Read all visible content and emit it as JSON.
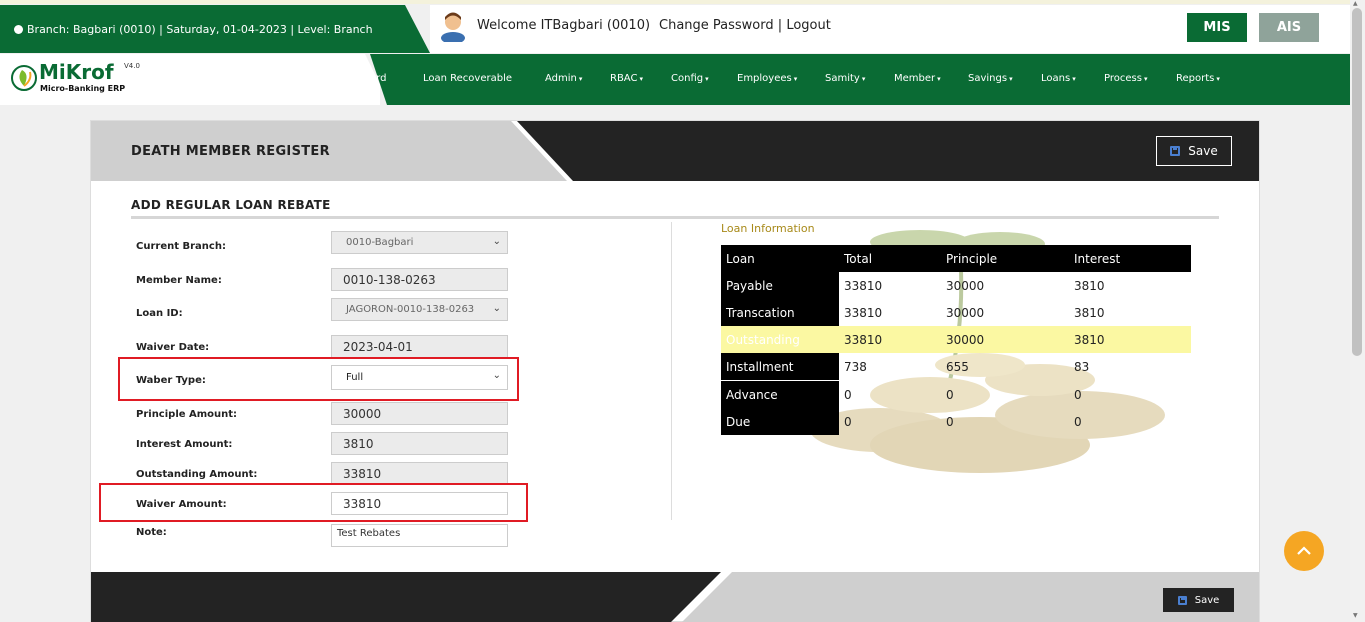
{
  "header": {
    "branch_info": "Branch: Bagbari (0010) | Saturday, 01-04-2023 | Level: Branch",
    "welcome": "Welcome ITBagbari (0010)",
    "change_password": "Change Password",
    "separator": "|",
    "logout": "Logout",
    "mis": "MIS",
    "ais": "AIS"
  },
  "logo": {
    "name": "MiKrof",
    "version": "V4.0",
    "subtitle": "Micro-Banking ERP"
  },
  "nav": {
    "items": [
      {
        "label": "ard"
      },
      {
        "label": "Loan Recoverable"
      },
      {
        "label": "Admin"
      },
      {
        "label": "RBAC"
      },
      {
        "label": "Config"
      },
      {
        "label": "Employees"
      },
      {
        "label": "Samity"
      },
      {
        "label": "Member"
      },
      {
        "label": "Savings"
      },
      {
        "label": "Loans"
      },
      {
        "label": "Process"
      },
      {
        "label": "Reports"
      }
    ]
  },
  "page": {
    "title": "DEATH MEMBER REGISTER",
    "save_label": "Save",
    "section_title": "ADD REGULAR LOAN REBATE"
  },
  "form": {
    "current_branch_label": "Current Branch:",
    "current_branch_value": "0010-Bagbari",
    "member_name_label": "Member Name:",
    "member_name_value": "0010-138-0263",
    "loan_id_label": "Loan ID:",
    "loan_id_value": "JAGORON-0010-138-0263",
    "waiver_date_label": "Waiver Date:",
    "waiver_date_value": "2023-04-01",
    "waber_type_label": "Waber Type:",
    "waber_type_value": "Full",
    "principle_amount_label": "Principle Amount:",
    "principle_amount_value": "30000",
    "interest_amount_label": "Interest Amount:",
    "interest_amount_value": "3810",
    "outstanding_amount_label": "Outstanding Amount:",
    "outstanding_amount_value": "33810",
    "waiver_amount_label": "Waiver Amount:",
    "waiver_amount_value": "33810",
    "note_label": "Note:",
    "note_value": "Test Rebates"
  },
  "loan_info": {
    "title": "Loan Information",
    "headers": [
      "Loan",
      "Total",
      "Principle",
      "Interest"
    ],
    "rows": [
      [
        "Payable",
        "33810",
        "30000",
        "3810"
      ],
      [
        "Transcation",
        "33810",
        "30000",
        "3810"
      ],
      [
        "Outstanding",
        "33810",
        "30000",
        "3810"
      ],
      [
        "Installment",
        "738",
        "655",
        "83"
      ],
      [
        "Advance",
        "0",
        "0",
        "0"
      ],
      [
        "Due",
        "0",
        "0",
        "0"
      ]
    ]
  },
  "footer": {
    "save_label": "Save"
  },
  "colors": {
    "brand_green": "#0a6b34",
    "accent_orange": "#f5a623",
    "highlight_red": "#e01b24",
    "highlight_yellow": "#fbf8a2"
  }
}
